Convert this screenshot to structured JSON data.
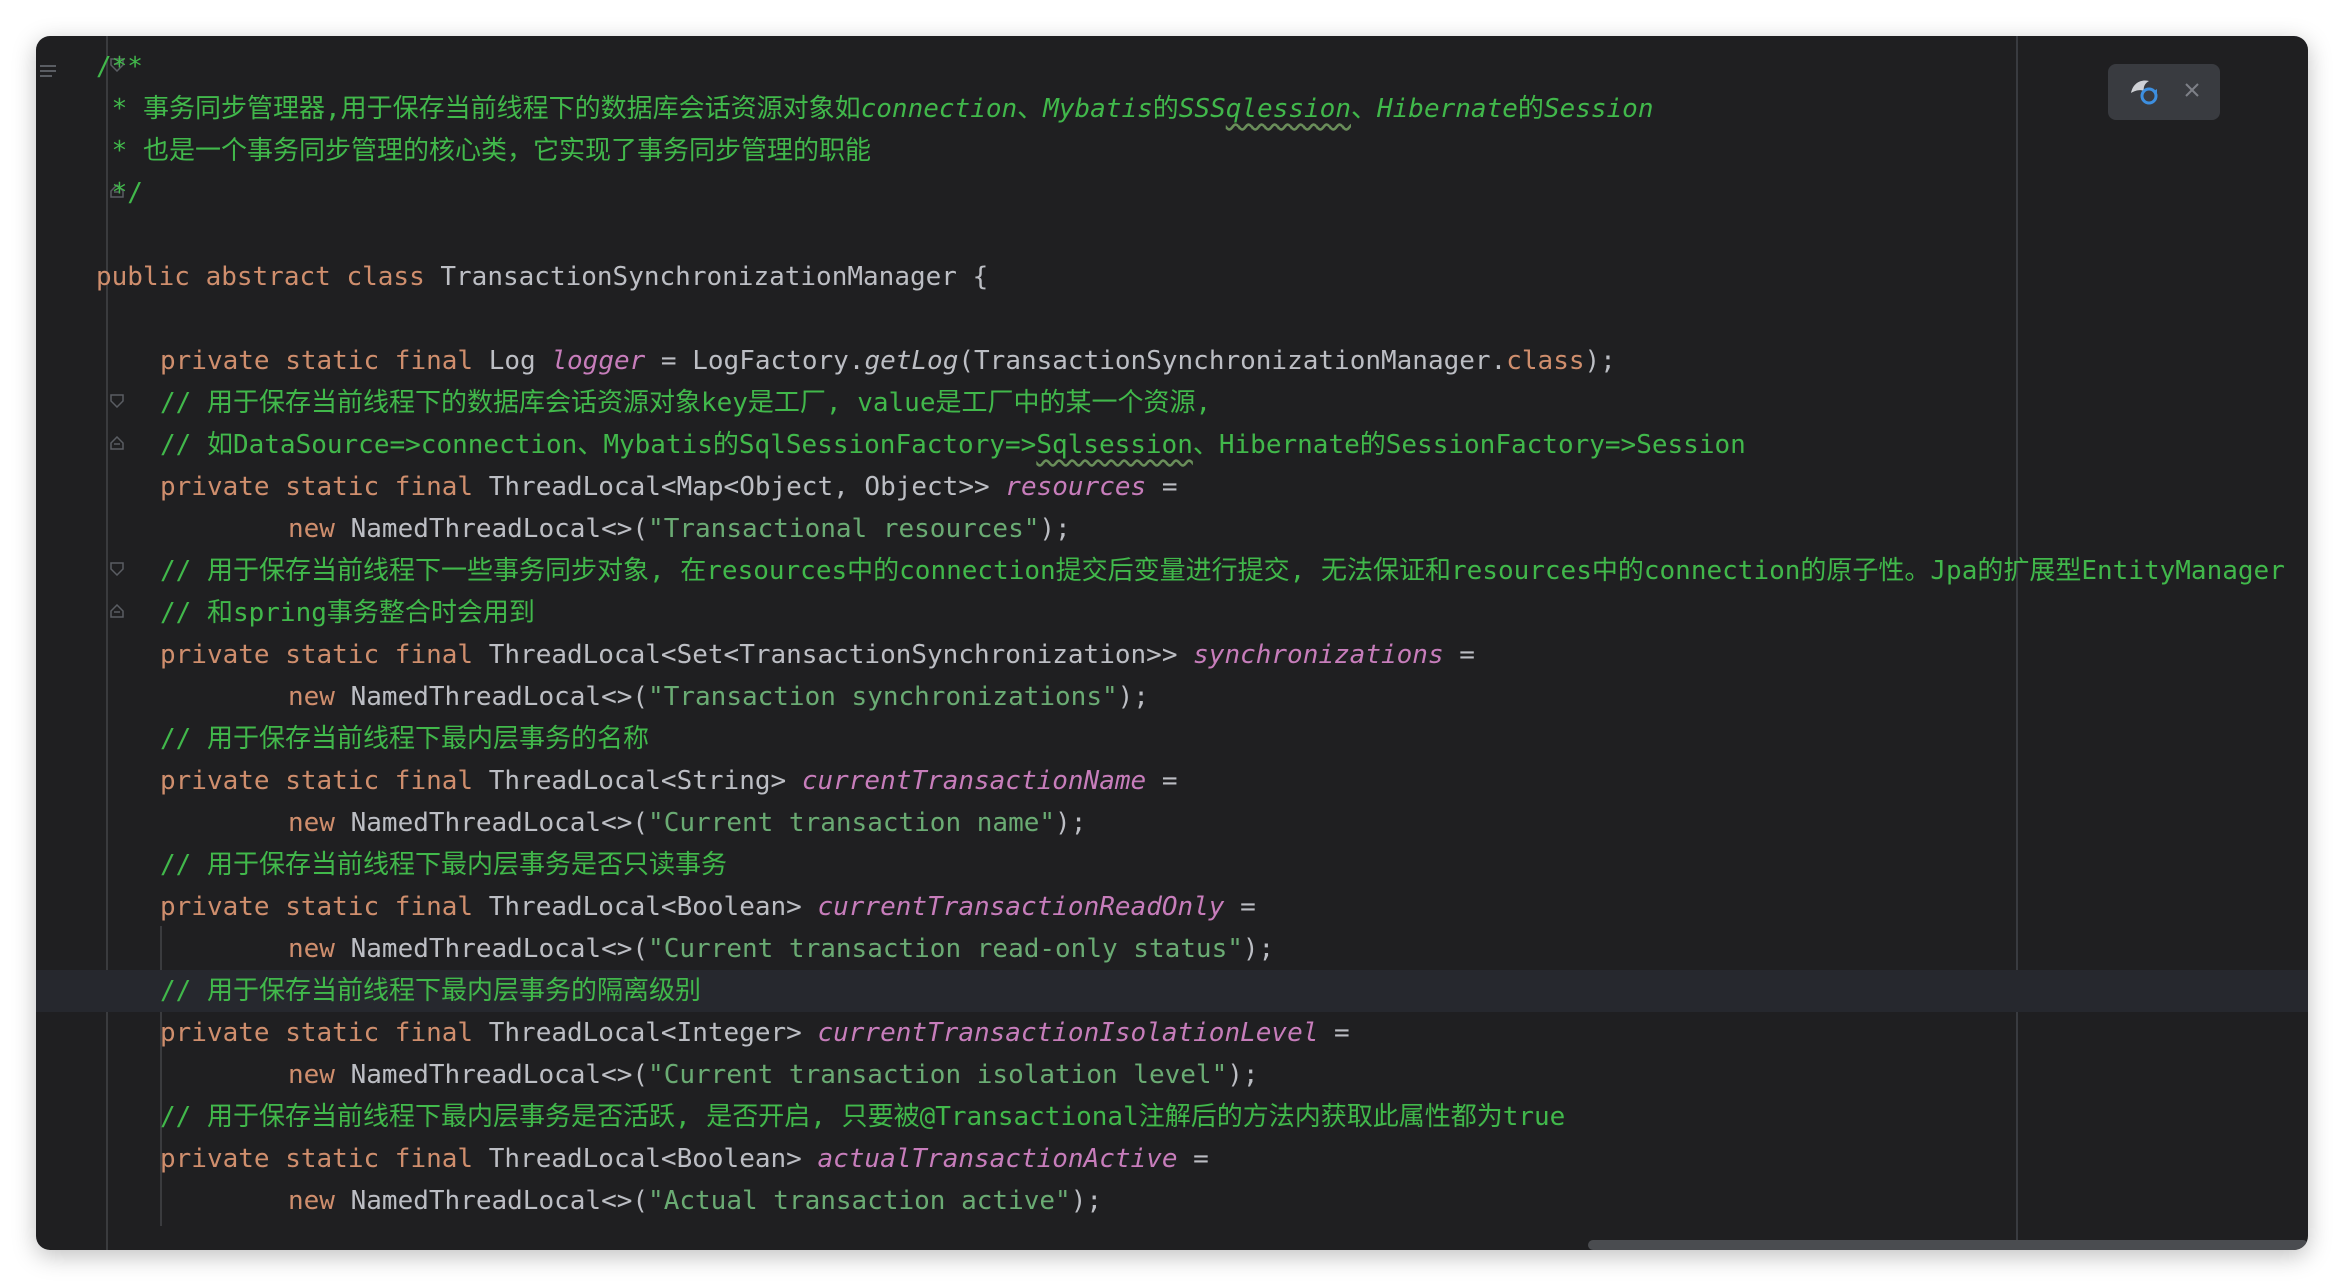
{
  "editor": {
    "language": "java",
    "highlighted_line_index": 23,
    "colors": {
      "background": "#1f1f21",
      "keyword": "#cf8e6d",
      "comment": "#41b84b",
      "string": "#6aab73",
      "field": "#c77dbb",
      "text": "#bcbec4"
    }
  },
  "code": {
    "l0": {
      "open": "/**"
    },
    "l1": {
      "prefix": " * 事务同步管理器,用于保存当前线程下的数据库会话资源对象如",
      "i1": "connection",
      "sep1": "、",
      "i2": "Mybatis",
      "zh1": "的",
      "i3": "SSS",
      "i4": "qlession",
      "sep2": "、",
      "i5": "Hibernate",
      "zh2": "的",
      "i6": "Session"
    },
    "l2": {
      "text": " * 也是一个事务同步管理的核心类，它实现了事务同步管理的职能"
    },
    "l3": {
      "text": " */"
    },
    "l5": {
      "kw": "public abstract class ",
      "name": "TransactionSynchronizationManager {"
    },
    "l7": {
      "kw": "private static final ",
      "type": "Log ",
      "field": "logger",
      "eq": " = LogFactory.",
      "method": "getLog",
      "args": "(TransactionSynchronizationManager.",
      "kw2": "class",
      "end": ");"
    },
    "l8": {
      "text": "// 用于保存当前线程下的数据库会话资源对象key是工厂, value是工厂中的某一个资源,"
    },
    "l9": {
      "pre": "// 如DataSource=>connection、Mybatis的SqlSessionFactory=>",
      "wave": "Sqlsession",
      "post": "、Hibernate的SessionFactory=>Session"
    },
    "l10": {
      "kw": "private static final ",
      "type": "ThreadLocal<Map<Object, Object>> ",
      "field": "resources",
      "eq": " ="
    },
    "l11": {
      "kw": "new ",
      "ctor": "NamedThreadLocal<>(",
      "str": "\"Transactional resources\"",
      "end": ");"
    },
    "l12": {
      "text": "// 用于保存当前线程下一些事务同步对象, 在resources中的connection提交后变量进行提交, 无法保证和resources中的connection的原子性。Jpa的扩展型EntityManager"
    },
    "l13": {
      "text": "// 和spring事务整合时会用到"
    },
    "l14": {
      "kw": "private static final ",
      "type": "ThreadLocal<Set<TransactionSynchronization>> ",
      "field": "synchronizations",
      "eq": " ="
    },
    "l15": {
      "kw": "new ",
      "ctor": "NamedThreadLocal<>(",
      "str": "\"Transaction synchronizations\"",
      "end": ");"
    },
    "l16": {
      "text": "// 用于保存当前线程下最内层事务的名称"
    },
    "l17": {
      "kw": "private static final ",
      "type": "ThreadLocal<String> ",
      "field": "currentTransactionName",
      "eq": " ="
    },
    "l18": {
      "kw": "new ",
      "ctor": "NamedThreadLocal<>(",
      "str": "\"Current transaction name\"",
      "end": ");"
    },
    "l19": {
      "text": "// 用于保存当前线程下最内层事务是否只读事务"
    },
    "l20": {
      "kw": "private static final ",
      "type": "ThreadLocal<Boolean> ",
      "field": "currentTransactionReadOnly",
      "eq": " ="
    },
    "l21": {
      "kw": "new ",
      "ctor": "NamedThreadLocal<>(",
      "str": "\"Current transaction read-only status\"",
      "end": ");"
    },
    "l22": {
      "text": "// 用于保存当前线程下最内层事务的隔离级别"
    },
    "l23": {
      "kw": "private static final ",
      "type": "ThreadLocal<Integer> ",
      "field": "currentTransactionIsolationLevel",
      "eq": " ="
    },
    "l24": {
      "kw": "new ",
      "ctor": "NamedThreadLocal<>(",
      "str": "\"Current transaction isolation level\"",
      "end": ");"
    },
    "l25": {
      "text": "// 用于保存当前线程下最内层事务是否活跃, 是否开启, 只要被@Transactional注解后的方法内获取此属性都为true"
    },
    "l26": {
      "kw": "private static final ",
      "type": "ThreadLocal<Boolean> ",
      "field": "actualTransactionActive",
      "eq": " ="
    },
    "l27": {
      "kw": "new ",
      "ctor": "NamedThreadLocal<>(",
      "str": "\"Actual transaction active\"",
      "end": ");"
    }
  },
  "widget": {
    "icons": [
      "translate-icon",
      "close-icon"
    ]
  }
}
